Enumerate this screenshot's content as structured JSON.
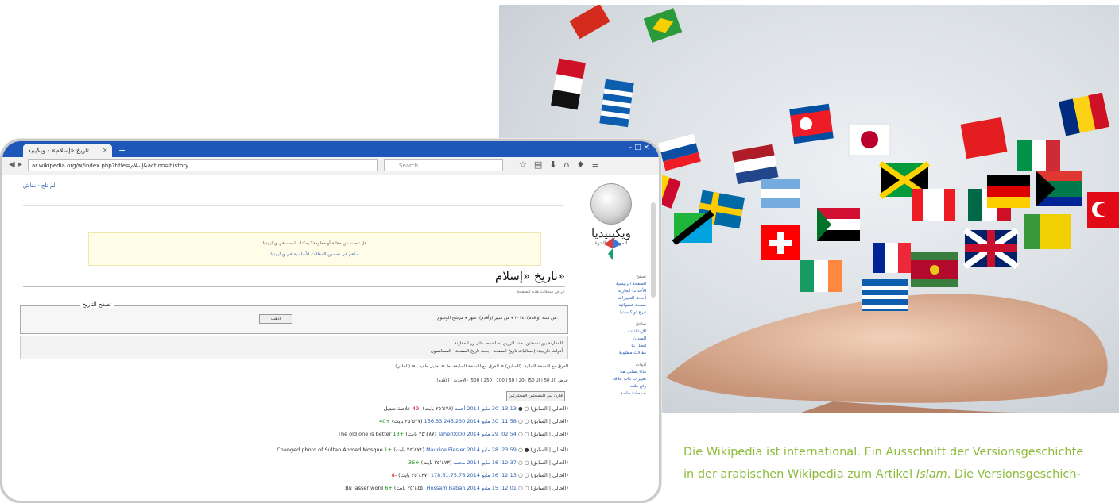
{
  "caption": {
    "line1": "Die Wikipedia ist international. Ein Ausschnitt der Versionsgeschichte",
    "line2_prefix": "in der arabischen Wikipedia zum Artikel ",
    "line2_italic": "Islam",
    "line2_suffix": ". Die Versionsgeschich-"
  },
  "colors": {
    "caption": "#8dbb3b",
    "browser_tabbar": "#1e57b8",
    "link": "#2a5db0"
  },
  "browser": {
    "tab_title": "تاريخ «إسلام» - ويكيبيد",
    "url": "ar.wikipedia.org/w/index.php?title=إسلام&action=history",
    "search_placeholder": "Search",
    "icons": [
      "back-icon",
      "reload-icon",
      "star-icon",
      "bookmark-list-icon",
      "download-icon",
      "home-icon",
      "menu-icon"
    ]
  },
  "wiki": {
    "logo_text": "ويكيبيديا",
    "logo_sub": "الموسوعة الحرة",
    "top_links": "لم تلج · نقاش",
    "page_title": "تاريخ «إسلام»",
    "subtitle": "عرض سجلات هذه الصفحة",
    "fieldset_legend": "تصفح التاريخ",
    "fieldset_row": "من سنة (وأقدم): ٢٠١٤ ▾ من شهر (وأقدم): شهر ▾ مرشح الوسوم:",
    "fieldset_button": "اذهب",
    "info_line1": "للمقارنة بين نسختين، حدد الزرين ثم اضغط على زر المقارنة",
    "info_line2": "أدوات خارجية: إحصائيات تاريخ الصفحة · بحث تاريخ الصفحة · المساهمون",
    "legend_line": "(الحالي) = الفرق مع النسخة الحالية، (السابق) = الفرق مع النسخة السابقة، ط = تعديل طفيف",
    "nav_line": "(الأحدث | الأقدم) عرض (الـ 50 | الـ 50) (20 | 50 | 100 | 250 | 500)",
    "compare_button": "قارن بين النسختين المختارتين",
    "sidebar_head1": "تصفح",
    "sidebar_links1": [
      "الصفحة الرئيسية",
      "الأحداث الجارية",
      "أحدث التغييرات",
      "صفحة عشوائية",
      "تبرع لويكيميديا"
    ],
    "sidebar_head2": "تفاعل",
    "sidebar_links2": [
      "الإرشادات",
      "الميدان",
      "اتصل بنا",
      "مقالات مطلوبة"
    ],
    "sidebar_head3": "أدوات",
    "sidebar_links3": [
      "ماذا يصلني هنا",
      "تغييرات ذات علاقة",
      "رفع ملف",
      "صفحات خاصة"
    ],
    "notice_line1": "هل تبحث عن مقالة أو معلومة؟ يمكنك البحث في ويكيبيديا",
    "notice_line2": "ساهم في تحسين المقالات الأساسية في ويكيبيديا",
    "revisions": [
      {
        "date": "13:13، 30 مايو 2014",
        "user": "أحمد",
        "bytes": "(٢٥٬٤٧٨ بايت)",
        "delta": "-49",
        "comment": "خلاصة تعديل"
      },
      {
        "date": "11:58، 30 مايو 2014",
        "user": "156.53.246.230",
        "bytes": "(٢٥٬٥٢٧ بايت)",
        "delta": "+40",
        "comment": ""
      },
      {
        "date": "02:54، 29 مايو 2014",
        "user": "Taher0000",
        "bytes": "(٢٥٬٤٨٧ بايت)",
        "delta": "+13",
        "comment": "The old one is better"
      },
      {
        "date": "23:59، 28 مايو 2014",
        "user": "Maurice Flesier",
        "bytes": "(٢٥٬٤٧٤ بايت)",
        "delta": "+1",
        "comment": "Changed photo of Sultan Ahmed Mosque"
      },
      {
        "date": "12:37، 16 مايو 2014",
        "user": "محمد",
        "bytes": "(٢٥٬٤٧٣ بايت)",
        "delta": "+36",
        "comment": ""
      },
      {
        "date": "12:13، 16 مايو 2014",
        "user": "178.61.75.76",
        "bytes": "(٢٥٬٤٣٧ بايت)",
        "delta": "-8",
        "comment": ""
      },
      {
        "date": "12:01، 15 مايو 2014",
        "user": "Hossam Babah",
        "bytes": "(٢٥٬٤٤٥ بايت)",
        "delta": "+6",
        "comment": "Bu lasser word"
      }
    ]
  }
}
